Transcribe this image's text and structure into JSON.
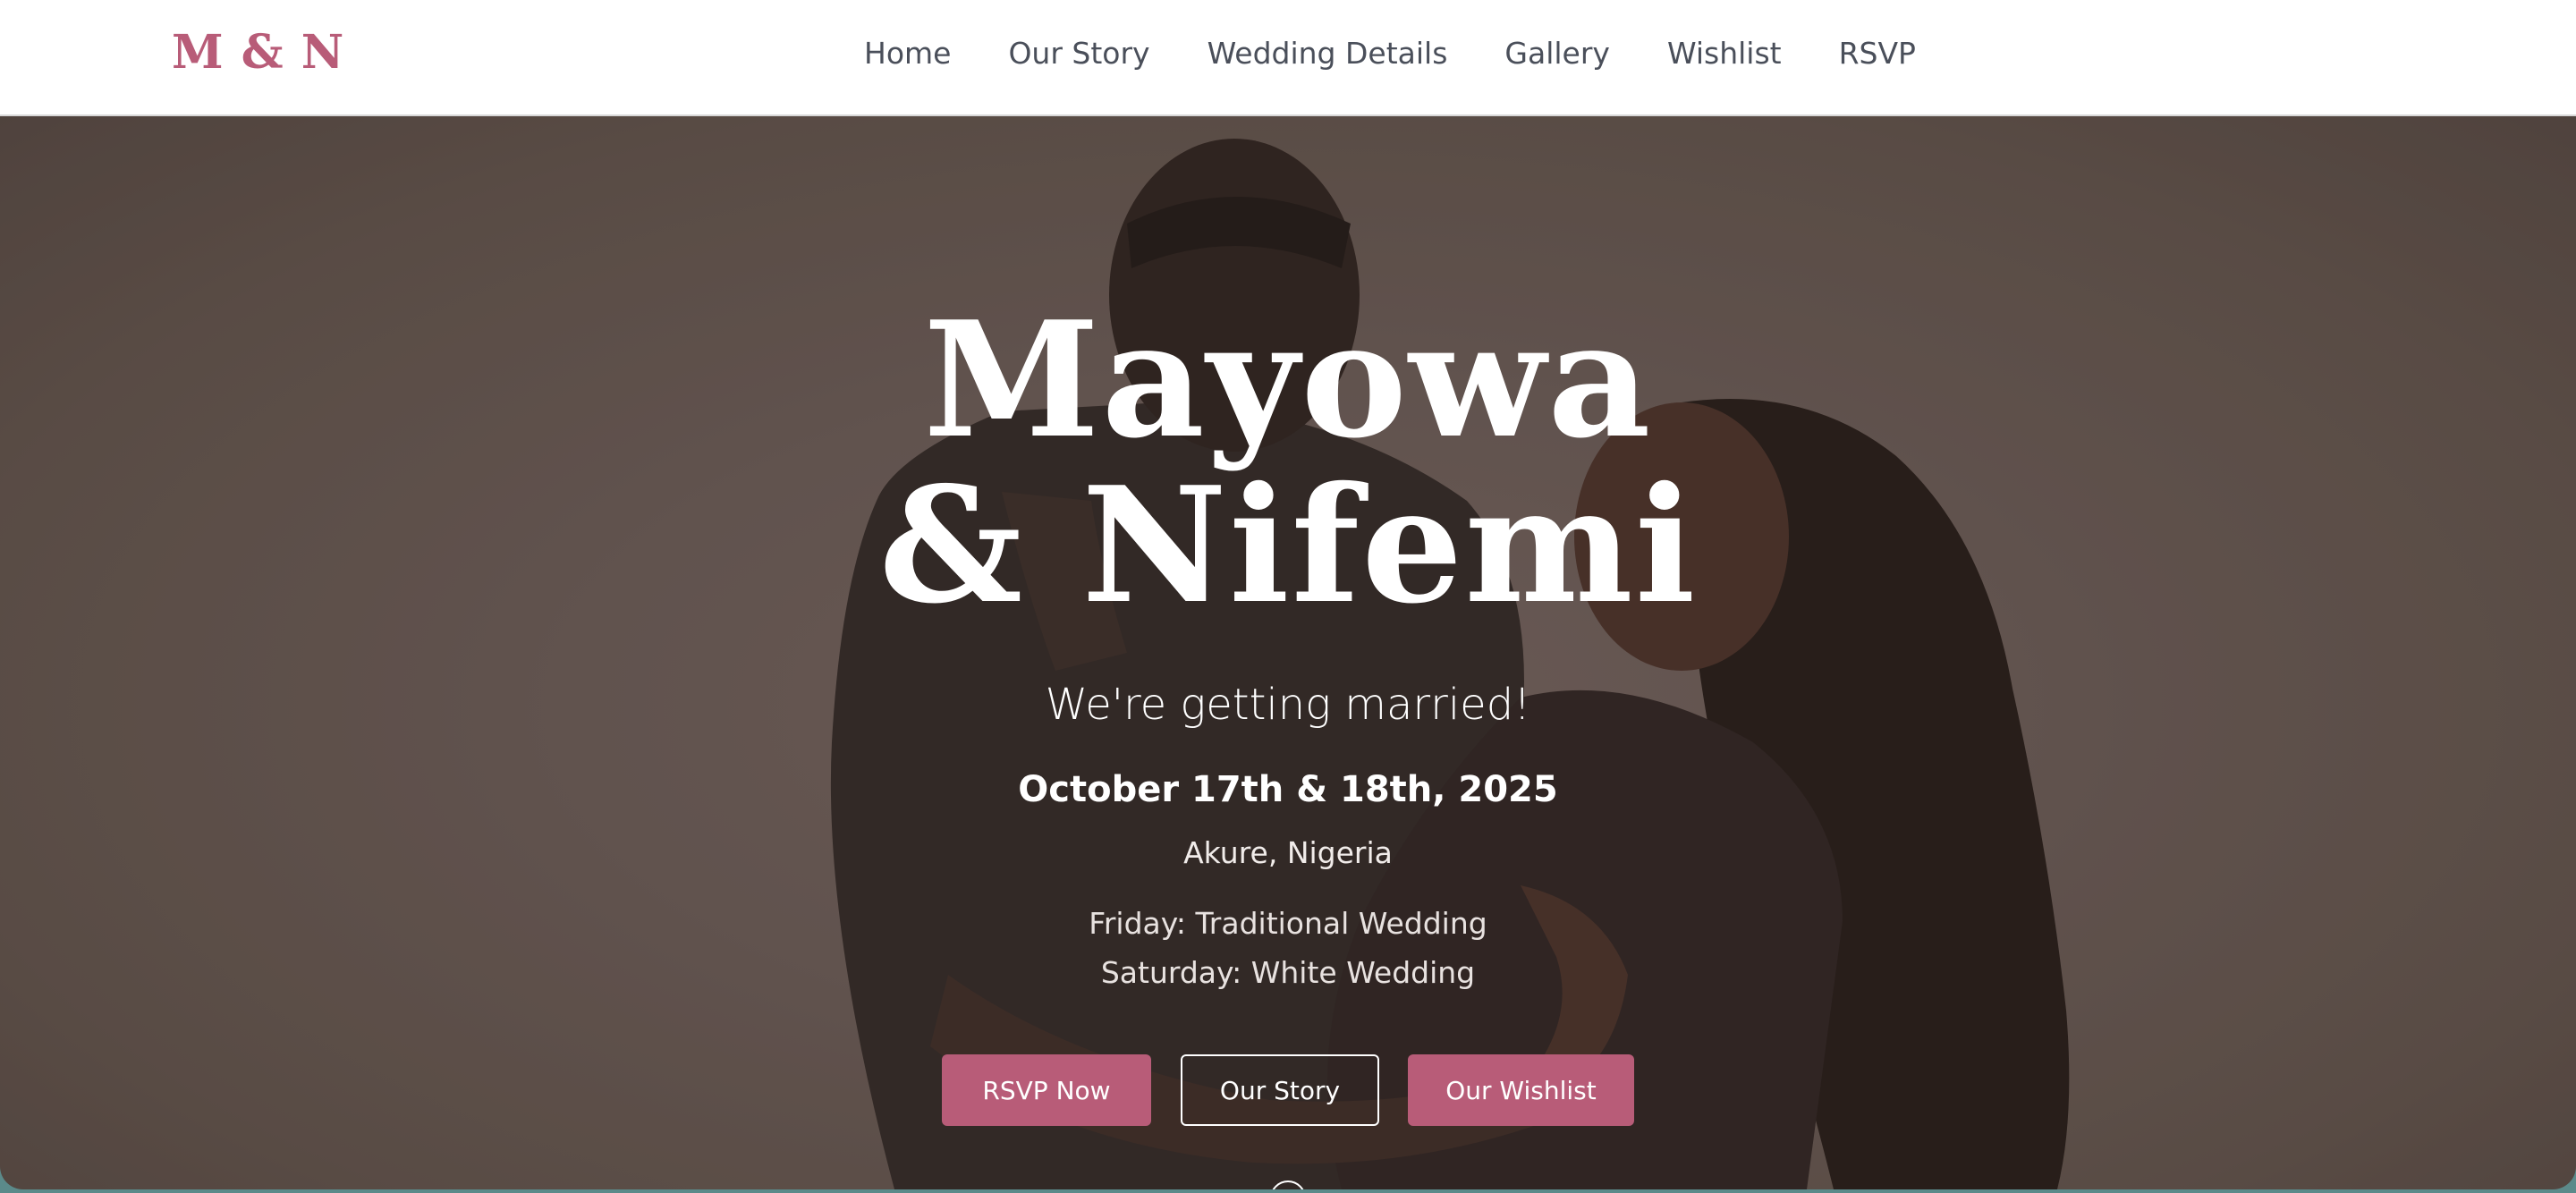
{
  "header": {
    "logo": "M & N",
    "nav": [
      "Home",
      "Our Story",
      "Wedding Details",
      "Gallery",
      "Wishlist",
      "RSVP"
    ]
  },
  "hero": {
    "title_line1": "Mayowa",
    "title_line2": "& Nifemi",
    "subtitle": "We're getting married!",
    "date": "October 17th & 18th, 2025",
    "location": "Akure, Nigeria",
    "events": [
      "Friday: Traditional Wedding",
      "Saturday: White Wedding"
    ],
    "buttons": {
      "rsvp": "RSVP Now",
      "story": "Our Story",
      "wishlist": "Our Wishlist"
    }
  },
  "colors": {
    "accent": "#b85c78",
    "nav_text": "#4a4f5a",
    "hero_bg": "#6f615c"
  }
}
